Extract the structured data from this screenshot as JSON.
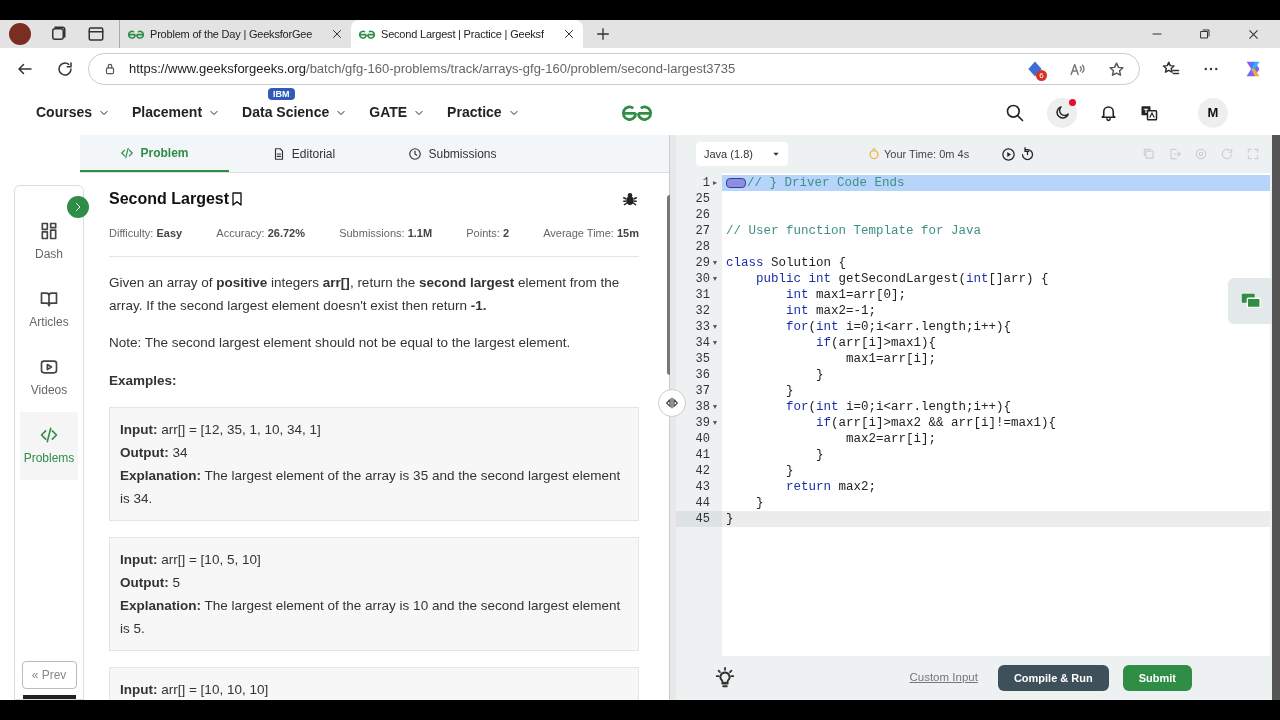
{
  "browser": {
    "tabs": [
      {
        "title": "Problem of the Day | GeeksforGee",
        "selected": false
      },
      {
        "title": "Second Largest | Practice | Geeksf",
        "selected": true
      }
    ],
    "url_host": "https://www.geeksforgeeks.org",
    "url_path": "/batch/gfg-160-problems/track/arrays-gfg-160/problem/second-largest3735",
    "extension_badge": "6"
  },
  "site_nav": {
    "items": [
      {
        "label": "Courses"
      },
      {
        "label": "Placement"
      },
      {
        "label": "Data Science",
        "badge": "IBM"
      },
      {
        "label": "GATE"
      },
      {
        "label": "Practice"
      }
    ],
    "avatar": "M"
  },
  "sidebar": {
    "items": [
      {
        "label": "Dash",
        "selected": false
      },
      {
        "label": "Articles",
        "selected": false
      },
      {
        "label": "Videos",
        "selected": false
      },
      {
        "label": "Problems",
        "selected": true
      }
    ],
    "prev": "« Prev"
  },
  "problem_tabs": [
    {
      "label": "Problem",
      "selected": true
    },
    {
      "label": "Editorial",
      "selected": false
    },
    {
      "label": "Submissions",
      "selected": false
    }
  ],
  "problem": {
    "title": "Second Largest",
    "stats": [
      {
        "label": "Difficulty:",
        "value": "Easy"
      },
      {
        "label": "Accuracy:",
        "value": "26.72%"
      },
      {
        "label": "Submissions:",
        "value": "1.1M"
      },
      {
        "label": "Points:",
        "value": "2"
      },
      {
        "label": "Average Time:",
        "value": "15m"
      }
    ],
    "description": "Given an array of **positive** integers **arr[]**, return the **second largest** element from the array. If the second largest element doesn't exist then return **-1.**",
    "note": "Note: The second largest element should not be equal to the largest element.",
    "examples_heading": "Examples:",
    "examples": [
      {
        "input_label": "Input:",
        "input": "arr[] = [12, 35, 1, 10, 34, 1]",
        "output_label": "Output:",
        "output": "34",
        "explanation_label": "Explanation:",
        "explanation": "The largest element of the array is 35 and the second largest element is 34."
      },
      {
        "input_label": "Input:",
        "input": "arr[] = [10, 5, 10]",
        "output_label": "Output:",
        "output": "5",
        "explanation_label": "Explanation:",
        "explanation": "The largest element of the array is 10 and the second largest element is 5."
      },
      {
        "input_label": "Input:",
        "input": "arr[] = [10, 10, 10]"
      }
    ]
  },
  "editor": {
    "language": "Java (1.8)",
    "timer": "Your Time: 0m 4s",
    "lines": [
      {
        "num": "1",
        "fold_marker": "▸",
        "selected": true,
        "current": false,
        "folded_marker": true,
        "tokens": [
          {
            "kind": "comment",
            "text": "// } Driver Code Ends"
          }
        ]
      },
      {
        "num": "25",
        "selected": false,
        "current": false
      },
      {
        "num": "26",
        "selected": false,
        "current": false
      },
      {
        "num": "27",
        "selected": false,
        "current": false,
        "tokens": [
          {
            "kind": "comment",
            "text": "// User function Template for Java"
          }
        ]
      },
      {
        "num": "28",
        "selected": false,
        "current": false
      },
      {
        "num": "29",
        "fold_marker": "▾",
        "selected": false,
        "current": false,
        "tokens": [
          {
            "kind": "keyword",
            "text": "class"
          },
          {
            "kind": "plain",
            "text": " Solution {"
          }
        ]
      },
      {
        "num": "30",
        "fold_marker": "▾",
        "selected": false,
        "current": false,
        "tokens": [
          {
            "kind": "keyword",
            "text": "    public int"
          },
          {
            "kind": "plain",
            "text": " getSecondLargest("
          },
          {
            "kind": "keyword",
            "text": "int"
          },
          {
            "kind": "plain",
            "text": "[]arr) {"
          }
        ]
      },
      {
        "num": "31",
        "selected": false,
        "current": false,
        "tokens": [
          {
            "kind": "keyword",
            "text": "        int"
          },
          {
            "kind": "plain",
            "text": " max1=arr[0];"
          }
        ]
      },
      {
        "num": "32",
        "selected": false,
        "current": false,
        "tokens": [
          {
            "kind": "keyword",
            "text": "        int"
          },
          {
            "kind": "plain",
            "text": " max2=-1;"
          }
        ]
      },
      {
        "num": "33",
        "fold_marker": "▾",
        "selected": false,
        "current": false,
        "tokens": [
          {
            "kind": "keyword",
            "text": "        for"
          },
          {
            "kind": "plain",
            "text": "("
          },
          {
            "kind": "keyword",
            "text": "int"
          },
          {
            "kind": "plain",
            "text": " i=0;i<arr.length;i++){"
          }
        ]
      },
      {
        "num": "34",
        "fold_marker": "▾",
        "selected": false,
        "current": false,
        "tokens": [
          {
            "kind": "keyword",
            "text": "            if"
          },
          {
            "kind": "plain",
            "text": "(arr[i]>max1){"
          }
        ]
      },
      {
        "num": "35",
        "selected": false,
        "current": false,
        "tokens": [
          {
            "kind": "plain",
            "text": "                max1=arr[i];"
          }
        ]
      },
      {
        "num": "36",
        "selected": false,
        "current": false,
        "tokens": [
          {
            "kind": "plain",
            "text": "            }"
          }
        ]
      },
      {
        "num": "37",
        "selected": false,
        "current": false,
        "tokens": [
          {
            "kind": "plain",
            "text": "        }"
          }
        ]
      },
      {
        "num": "38",
        "fold_marker": "▾",
        "selected": false,
        "current": false,
        "tokens": [
          {
            "kind": "keyword",
            "text": "        for"
          },
          {
            "kind": "plain",
            "text": "("
          },
          {
            "kind": "keyword",
            "text": "int"
          },
          {
            "kind": "plain",
            "text": " i=0;i<arr.length;i++){"
          }
        ]
      },
      {
        "num": "39",
        "fold_marker": "▾",
        "selected": false,
        "current": false,
        "tokens": [
          {
            "kind": "keyword",
            "text": "            if"
          },
          {
            "kind": "plain",
            "text": "(arr[i]>max2 && arr[i]!=max1){"
          }
        ]
      },
      {
        "num": "40",
        "selected": false,
        "current": false,
        "tokens": [
          {
            "kind": "plain",
            "text": "                max2=arr[i];"
          }
        ]
      },
      {
        "num": "41",
        "selected": false,
        "current": false,
        "tokens": [
          {
            "kind": "plain",
            "text": "            }"
          }
        ]
      },
      {
        "num": "42",
        "selected": false,
        "current": false,
        "tokens": [
          {
            "kind": "plain",
            "text": "        }"
          }
        ]
      },
      {
        "num": "43",
        "selected": false,
        "current": false,
        "tokens": [
          {
            "kind": "keyword",
            "text": "        return"
          },
          {
            "kind": "plain",
            "text": " max2;"
          }
        ]
      },
      {
        "num": "44",
        "selected": false,
        "current": false,
        "tokens": [
          {
            "kind": "plain",
            "text": "    }"
          }
        ]
      },
      {
        "num": "45",
        "selected": false,
        "current": true,
        "tokens": [
          {
            "kind": "plain",
            "text": "}"
          }
        ]
      }
    ],
    "custom_input": "Custom Input",
    "compile": "Compile & Run",
    "submit": "Submit"
  }
}
